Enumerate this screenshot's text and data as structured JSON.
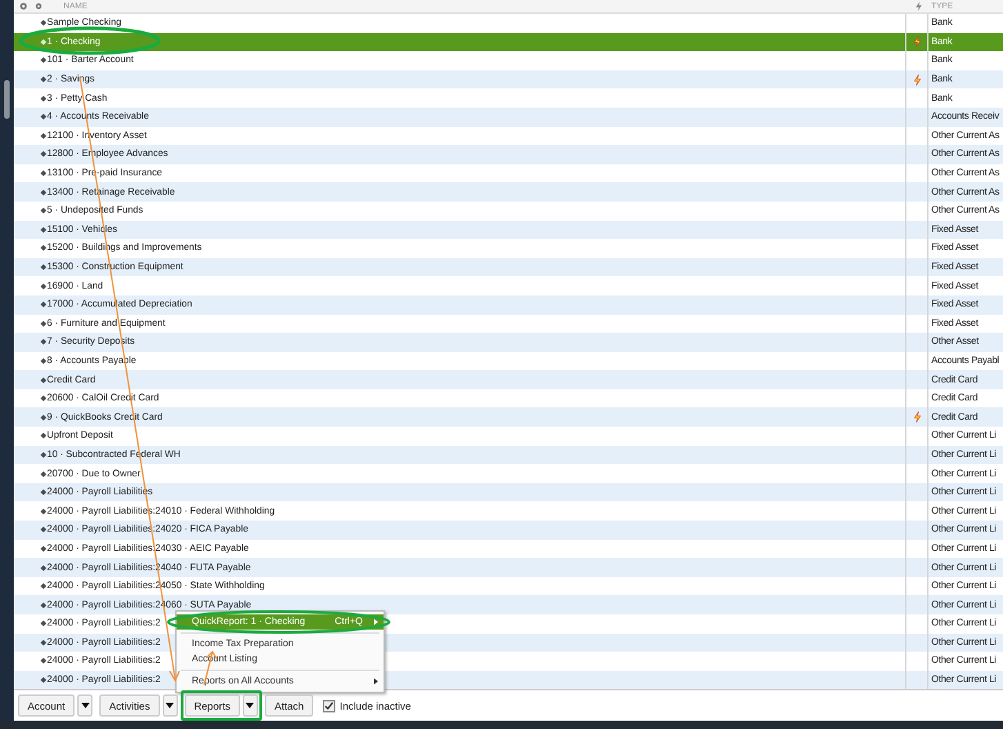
{
  "table": {
    "columns": [
      {
        "label": "NAME"
      },
      {
        "label": "TYPE"
      }
    ],
    "rows": [
      {
        "name": "Sample Checking",
        "type": "Bank",
        "online": false,
        "selected": false
      },
      {
        "name": "1 · Checking",
        "type": "Bank",
        "online": true,
        "selected": true
      },
      {
        "name": "101 · Barter Account",
        "type": "Bank",
        "online": false,
        "selected": false
      },
      {
        "name": "2 · Savings",
        "type": "Bank",
        "online": true,
        "selected": false
      },
      {
        "name": "3 · Petty Cash",
        "type": "Bank",
        "online": false,
        "selected": false
      },
      {
        "name": "4 · Accounts Receivable",
        "type": "Accounts Receiv",
        "online": false,
        "selected": false
      },
      {
        "name": "12100 · Inventory Asset",
        "type": "Other Current As",
        "online": false,
        "selected": false
      },
      {
        "name": "12800 · Employee Advances",
        "type": "Other Current As",
        "online": false,
        "selected": false
      },
      {
        "name": "13100 · Pre-paid Insurance",
        "type": "Other Current As",
        "online": false,
        "selected": false
      },
      {
        "name": "13400 · Retainage Receivable",
        "type": "Other Current As",
        "online": false,
        "selected": false
      },
      {
        "name": "5 · Undeposited Funds",
        "type": "Other Current As",
        "online": false,
        "selected": false
      },
      {
        "name": "15100 · Vehicles",
        "type": "Fixed Asset",
        "online": false,
        "selected": false
      },
      {
        "name": "15200 · Buildings and Improvements",
        "type": "Fixed Asset",
        "online": false,
        "selected": false
      },
      {
        "name": "15300 · Construction Equipment",
        "type": "Fixed Asset",
        "online": false,
        "selected": false
      },
      {
        "name": "16900 · Land",
        "type": "Fixed Asset",
        "online": false,
        "selected": false
      },
      {
        "name": "17000 · Accumulated Depreciation",
        "type": "Fixed Asset",
        "online": false,
        "selected": false
      },
      {
        "name": "6 · Furniture and Equipment",
        "type": "Fixed Asset",
        "online": false,
        "selected": false
      },
      {
        "name": "7 · Security Deposits",
        "type": "Other Asset",
        "online": false,
        "selected": false
      },
      {
        "name": "8 · Accounts Payable",
        "type": "Accounts Payabl",
        "online": false,
        "selected": false
      },
      {
        "name": "Credit Card",
        "type": "Credit Card",
        "online": false,
        "selected": false
      },
      {
        "name": "20600 · CalOil Credit Card",
        "type": "Credit Card",
        "online": false,
        "selected": false
      },
      {
        "name": "9 · QuickBooks Credit Card",
        "type": "Credit Card",
        "online": true,
        "selected": false
      },
      {
        "name": "Upfront Deposit",
        "type": "Other Current Li",
        "online": false,
        "selected": false
      },
      {
        "name": "10 · Subcontracted Federal WH",
        "type": "Other Current Li",
        "online": false,
        "selected": false
      },
      {
        "name": "20700 · Due to Owner",
        "type": "Other Current Li",
        "online": false,
        "selected": false
      },
      {
        "name": "24000 · Payroll Liabilities",
        "type": "Other Current Li",
        "online": false,
        "selected": false
      },
      {
        "name": "24000 · Payroll Liabilities:24010 · Federal Withholding",
        "type": "Other Current Li",
        "online": false,
        "selected": false
      },
      {
        "name": "24000 · Payroll Liabilities:24020 · FICA Payable",
        "type": "Other Current Li",
        "online": false,
        "selected": false
      },
      {
        "name": "24000 · Payroll Liabilities:24030 · AEIC Payable",
        "type": "Other Current Li",
        "online": false,
        "selected": false
      },
      {
        "name": "24000 · Payroll Liabilities:24040 · FUTA Payable",
        "type": "Other Current Li",
        "online": false,
        "selected": false
      },
      {
        "name": "24000 · Payroll Liabilities:24050 · State Withholding",
        "type": "Other Current Li",
        "online": false,
        "selected": false
      },
      {
        "name": "24000 · Payroll Liabilities:24060 · SUTA Payable",
        "type": "Other Current Li",
        "online": false,
        "selected": false
      },
      {
        "name": "24000 · Payroll Liabilities:2",
        "type": "Other Current Li",
        "online": false,
        "selected": false
      },
      {
        "name": "24000 · Payroll Liabilities:2",
        "type": "Other Current Li",
        "online": false,
        "selected": false
      },
      {
        "name": "24000 · Payroll Liabilities:2",
        "type": "Other Current Li",
        "online": false,
        "selected": false
      },
      {
        "name": "24000 · Payroll Liabilities:2",
        "type": "Other Current Li",
        "online": false,
        "selected": false
      }
    ]
  },
  "menu": {
    "items": [
      {
        "kind": "item",
        "label": "QuickReport: 1 · Checking",
        "shortcut": "Ctrl+Q",
        "selected": true,
        "submenu": true
      },
      {
        "kind": "separator"
      },
      {
        "kind": "item",
        "label": "Income Tax Preparation",
        "selected": false,
        "submenu": false
      },
      {
        "kind": "item",
        "label": "Account Listing",
        "selected": false,
        "submenu": false
      },
      {
        "kind": "separator"
      },
      {
        "kind": "item",
        "label": "Reports on All Accounts",
        "selected": false,
        "submenu": true
      }
    ]
  },
  "toolbar": {
    "buttons": [
      {
        "label": "Account",
        "dropdown": true,
        "annotated": false
      },
      {
        "label": "Activities",
        "dropdown": true,
        "annotated": false
      },
      {
        "label": "Reports",
        "dropdown": true,
        "annotated": true
      },
      {
        "label": "Attach",
        "dropdown": false,
        "annotated": false
      }
    ],
    "include_inactive": {
      "label": "Include inactive",
      "checked": true
    }
  }
}
